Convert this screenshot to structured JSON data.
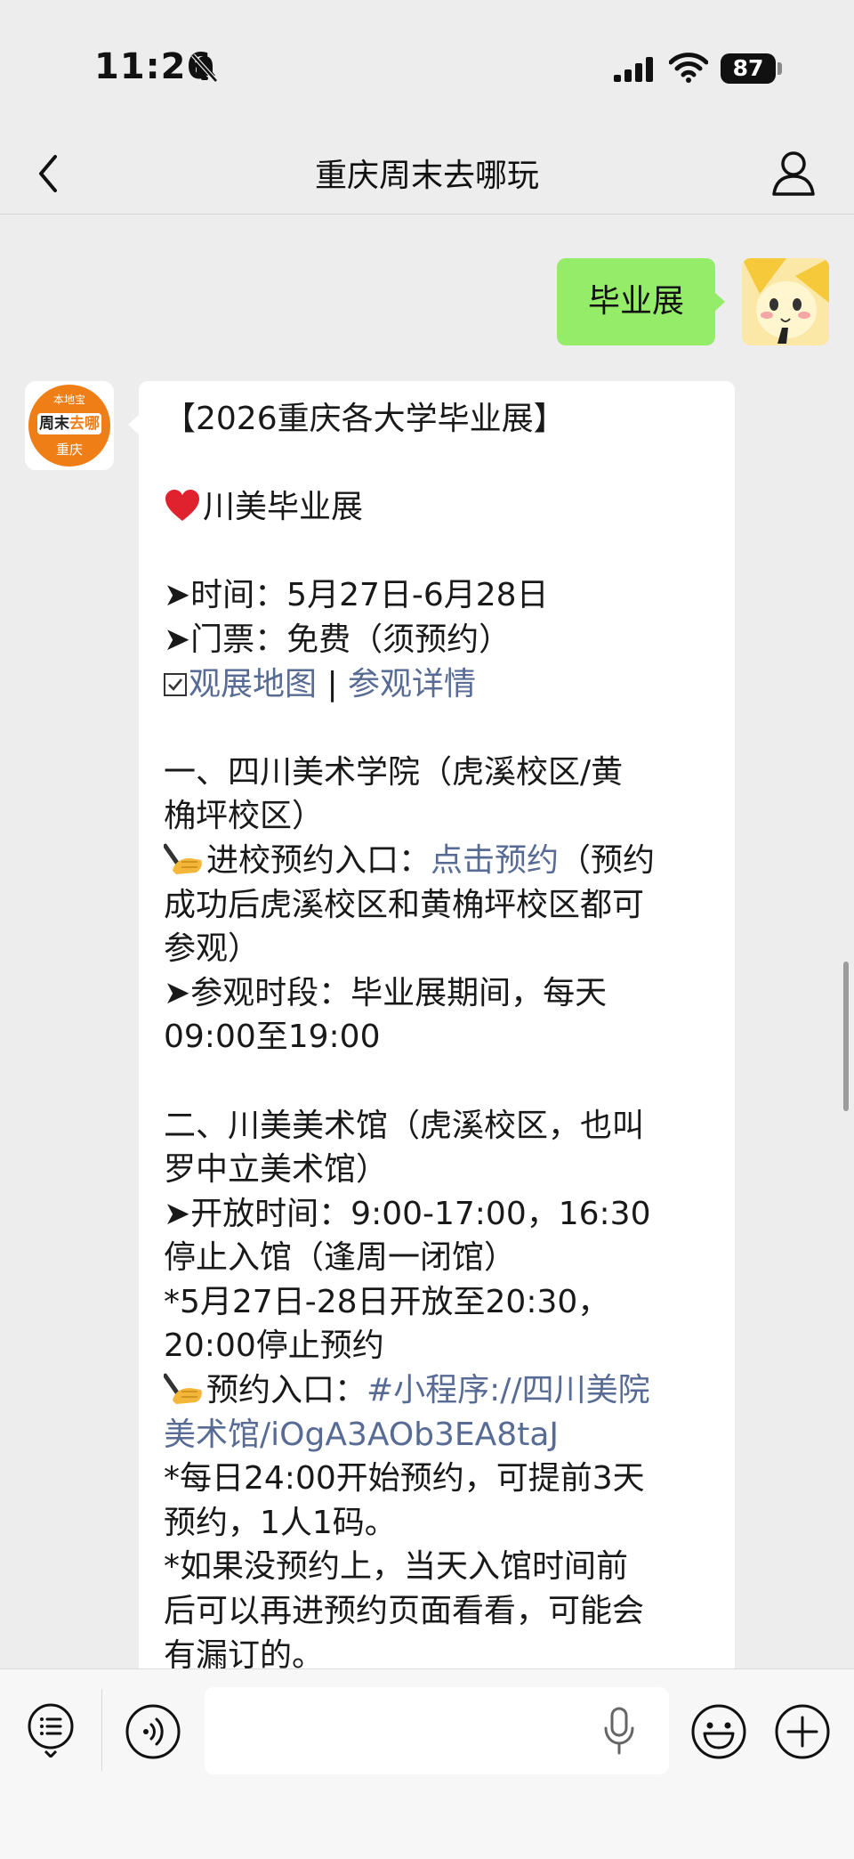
{
  "status_bar": {
    "time": "11:26",
    "battery": "87"
  },
  "nav": {
    "title": "重庆周末去哪玩"
  },
  "outgoing": {
    "text": "毕业展"
  },
  "channel_avatar": {
    "top": "本地宝",
    "brand_a": "周末",
    "brand_b": "去哪",
    "city": "重庆"
  },
  "message": {
    "line_01": "【2026重庆各大学毕业展】",
    "line_02": "",
    "line_03": "川美毕业展",
    "line_04": "",
    "line_05": "➤时间：5月27日-6月28日",
    "line_06": "➤门票：免费（须预约）",
    "line_07_link_a": "观展地图",
    "line_07_sep": " | ",
    "line_07_link_b": "参观详情",
    "line_08": "",
    "line_09": "一、四川美术学院（虎溪校区/黄",
    "line_10": "桷坪校区）",
    "line_11_pre": "进校预约入口：",
    "line_11_link": "点击预约",
    "line_11_post": "（预约",
    "line_12": "成功后虎溪校区和黄桷坪校区都可",
    "line_13": "参观）",
    "line_14": "➤参观时段：毕业展期间，每天",
    "line_15": "09:00至19:00",
    "line_16": "",
    "line_17": "二、川美美术馆（虎溪校区，也叫",
    "line_18": "罗中立美术馆）",
    "line_19": "➤开放时间：9:00-17:00，16:30",
    "line_20": "停止入馆（逢周一闭馆）",
    "line_21": "*5月27日-28日开放至20:30，",
    "line_22": "20:00停止预约",
    "line_23_pre": "预约入口：",
    "line_23_link": "#小程序://四川美院",
    "line_24_link": "美术馆/iOgA3AOb3EA8taJ",
    "line_25": "*每日24:00开始预约，可提前3天",
    "line_26": "预约，1人1码。",
    "line_27": "*如果没预约上，当天入馆时间前",
    "line_28": "后可以再进预约页面看看，可能会",
    "line_29": "有漏订的。"
  },
  "icons": {
    "heart": "red-heart-emoji",
    "hand": "writing-hand-emoji",
    "check": "ballot-box-with-check"
  },
  "colors": {
    "link": "#576b95",
    "outgoing_bubble": "#95ec69",
    "brand": "#f07e16",
    "background": "#ededed"
  }
}
